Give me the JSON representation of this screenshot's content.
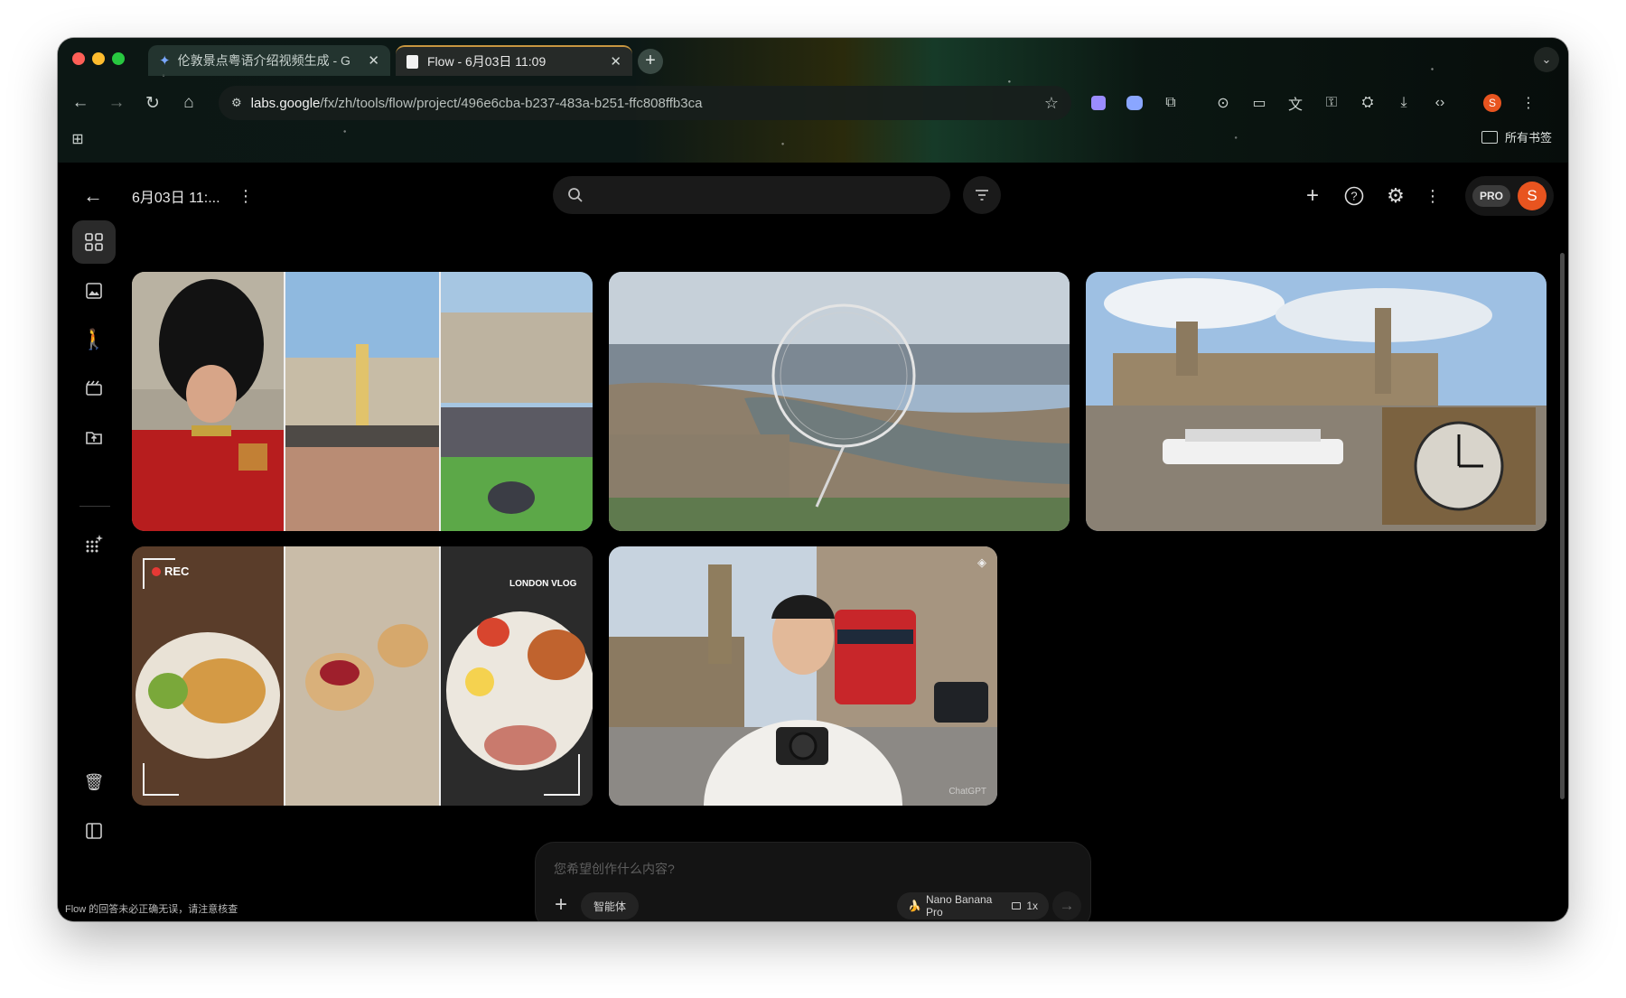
{
  "browser": {
    "tabs": [
      {
        "title": "伦敦景点粤语介绍视频生成 - G",
        "active": false
      },
      {
        "title": "Flow - 6月03日 11:09",
        "active": true
      }
    ],
    "new_tab_symbol": "+",
    "tab_list_symbol": "⌄",
    "url": {
      "host": "labs.google",
      "path": "/fx/zh/tools/flow/project/496e6cba-b237-483a-b251-ffc808ffb3ca"
    },
    "profile_initial": "S",
    "bookmarks_label": "所有书签",
    "traffic_colors": {
      "close": "#ff5f57",
      "minimize": "#febc2e",
      "zoom": "#28c840"
    }
  },
  "app": {
    "project_title": "6月03日 11:...",
    "pro_badge": "PRO",
    "user_initial": "S",
    "accent": "#e8541f",
    "tiles": [
      {
        "name": "buckingham-palace-collage",
        "overlay": ""
      },
      {
        "name": "london-eye-aerial",
        "overlay": ""
      },
      {
        "name": "westminster-big-ben-boat",
        "overlay": ""
      },
      {
        "name": "london-food-vlog-collage",
        "overlay": "REC",
        "overlay2": "LONDON VLOG"
      },
      {
        "name": "tourist-big-ben-selfie",
        "overlay": "ChatGPT"
      }
    ],
    "composer": {
      "placeholder": "您希望创作什么内容?",
      "agent_chip": "智能体",
      "model_chip": "Nano Banana Pro",
      "ratio_label": "1x"
    },
    "disclaimer": "Flow 的回答未必正确无误，请注意核查"
  }
}
